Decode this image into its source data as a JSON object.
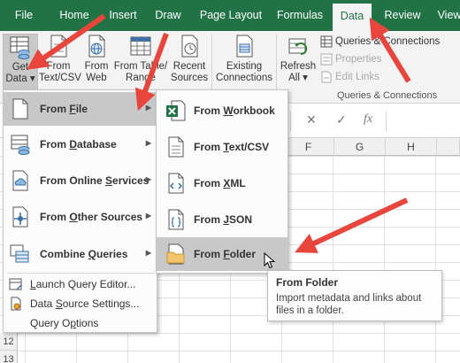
{
  "tabs": [
    {
      "label": "File",
      "active": false
    },
    {
      "label": "Home",
      "active": false
    },
    {
      "label": "Insert",
      "active": false
    },
    {
      "label": "Draw",
      "active": false
    },
    {
      "label": "Page Layout",
      "active": false
    },
    {
      "label": "Formulas",
      "active": false
    },
    {
      "label": "Data",
      "active": true
    },
    {
      "label": "Review",
      "active": false
    },
    {
      "label": "View",
      "active": false
    }
  ],
  "ribbon": {
    "get_data": {
      "line1": "Get",
      "line2": "Data",
      "dropdown_glyph": "▾",
      "icon": "get-data-icon"
    },
    "from_text_csv": {
      "line1": "From",
      "line2": "Text/CSV",
      "icon": "text-csv-icon"
    },
    "from_web": {
      "line1": "From",
      "line2": "Web",
      "icon": "web-icon"
    },
    "from_table_range": {
      "line1": "From Table/",
      "line2": "Range",
      "icon": "table-icon"
    },
    "recent_sources": {
      "line1": "Recent",
      "line2": "Sources",
      "icon": "recent-sources-icon"
    },
    "existing_connections": {
      "line1": "Existing",
      "line2": "Connections",
      "icon": "existing-connections-icon"
    },
    "refresh_all": {
      "line1": "Refresh",
      "line2": "All",
      "dropdown_glyph": "▾",
      "icon": "refresh-icon"
    },
    "queries_connections": {
      "label": "Queries & Connections",
      "icon": "queries-icon"
    },
    "properties": {
      "label": "Properties",
      "icon": "properties-icon"
    },
    "edit_links": {
      "label": "Edit Links",
      "icon": "edit-links-icon"
    },
    "group_label": "Queries & Connections"
  },
  "formula_bar": {
    "cancel": "✕",
    "enter": "✓",
    "fx": "fx"
  },
  "columns": [
    "F",
    "G",
    "H"
  ],
  "rows": [
    "12",
    "13"
  ],
  "get_data_menu": {
    "items": [
      {
        "label": "From File",
        "mnemonic": "F",
        "icon": "file-icon",
        "has_submenu": true,
        "highlighted": true
      },
      {
        "label": "From Database",
        "mnemonic": "D",
        "icon": "database-icon",
        "has_submenu": true,
        "highlighted": false
      },
      {
        "label": "From Online Services",
        "mnemonic": "S",
        "icon": "online-services-icon",
        "has_submenu": true,
        "highlighted": false
      },
      {
        "label": "From Other Sources",
        "mnemonic": "O",
        "icon": "other-sources-icon",
        "has_submenu": true,
        "highlighted": false
      },
      {
        "label": "Combine Queries",
        "mnemonic": "Q",
        "icon": "combine-queries-icon",
        "has_submenu": true,
        "highlighted": false
      }
    ],
    "small_items": [
      {
        "label": "Launch Query Editor...",
        "mnemonic": "L",
        "icon": "query-editor-icon"
      },
      {
        "label": "Data Source Settings...",
        "mnemonic": "S",
        "icon": "data-source-settings-icon"
      },
      {
        "label": "Query Options",
        "mnemonic": "p",
        "icon": "query-options-icon"
      }
    ]
  },
  "from_file_menu": {
    "items": [
      {
        "label": "From Workbook",
        "mnemonic": "W",
        "icon": "workbook-icon",
        "highlighted": false
      },
      {
        "label": "From Text/CSV",
        "mnemonic": "T",
        "icon": "text-csv-file-icon",
        "highlighted": false
      },
      {
        "label": "From XML",
        "mnemonic": "X",
        "icon": "xml-icon",
        "highlighted": false
      },
      {
        "label": "From JSON",
        "mnemonic": "J",
        "icon": "json-icon",
        "highlighted": false
      },
      {
        "label": "From Folder",
        "mnemonic": "F",
        "icon": "folder-icon",
        "highlighted": true
      }
    ]
  },
  "tooltip": {
    "title": "From Folder",
    "body_line1": "Import metadata and links about",
    "body_line2": "files in a folder."
  },
  "colors": {
    "ribbon_green": "#217346",
    "annotation_red": "#e8453c",
    "menu_highlight": "#c8c8c8"
  }
}
